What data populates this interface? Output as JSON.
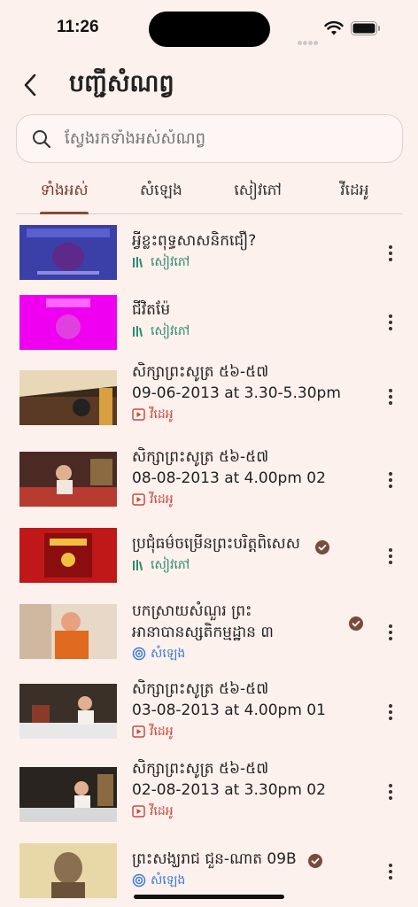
{
  "status": {
    "time": "11:26"
  },
  "header": {
    "title": "បញ្ជីសំណព្វ"
  },
  "search": {
    "placeholder": "ស្វែងរកទាំងអស់សំណព្វ"
  },
  "tabs": [
    {
      "label": "ទាំងអស់",
      "active": true
    },
    {
      "label": "សំឡេង",
      "active": false
    },
    {
      "label": "សៀវភៅ",
      "active": false
    },
    {
      "label": "វីដេអូ",
      "active": false
    }
  ],
  "items": [
    {
      "title": "អ្វីខ្លះពុទ្ធសាសនិកជឿ?",
      "type": "សៀវភៅ",
      "kind": "book",
      "verified": false
    },
    {
      "title": "ជីវិតម៉ែ",
      "type": "សៀវភៅ",
      "kind": "book",
      "verified": false
    },
    {
      "title": "សិក្សាព្រះសូត្រ ៥៦-៥៧",
      "subtitle": "09-06-2013 at 3.30-5.30pm",
      "type": "វីដេអូ",
      "kind": "video",
      "verified": false
    },
    {
      "title": "សិក្សាព្រះសូត្រ ៥៦-៥៧",
      "subtitle": "08-08-2013 at 4.00pm 02",
      "type": "វីដេអូ",
      "kind": "video",
      "verified": false
    },
    {
      "title": "ប្រជុំធម៌ចម្រើនព្រះបរិត្តពិសេស",
      "type": "សៀវភៅ",
      "kind": "book",
      "verified": true
    },
    {
      "title": "បកស្រាយសំណួរ ព្រះ",
      "subtitle": "អានាបានស្សតិកម្មដ្ឋាន ៣",
      "type": "សំឡេង",
      "kind": "audio",
      "verified": true
    },
    {
      "title": "សិក្សាព្រះសូត្រ ៥៦-៥៧",
      "subtitle": "03-08-2013 at 4.00pm 01",
      "type": "វីដេអូ",
      "kind": "video",
      "verified": false
    },
    {
      "title": "សិក្សាព្រះសូត្រ ៥៦-៥៧",
      "subtitle": "02-08-2013 at 3.30pm 02",
      "type": "វីដេអូ",
      "kind": "video",
      "verified": false
    },
    {
      "title": "ព្រះសង្ឃរាជ ជួន-ណាត 09B",
      "type": "សំឡេង",
      "kind": "audio",
      "verified": true
    }
  ],
  "colors": {
    "background": "#fdf1ee",
    "accent": "#8b4a36",
    "book": "#2e8c6e",
    "video": "#c94a3f",
    "audio": "#3a7bd5"
  }
}
